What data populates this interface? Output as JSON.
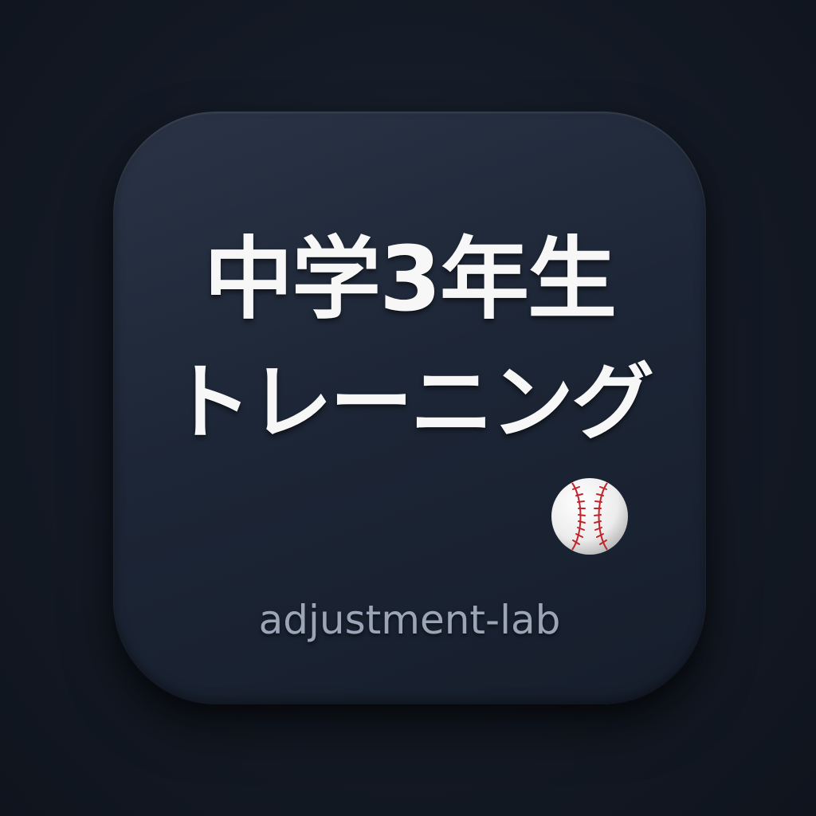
{
  "icon": {
    "title_line_1": "中学3年生",
    "title_line_2": "トレーニング",
    "brand": "adjustment-lab",
    "badge_icon": "baseball-icon"
  },
  "colors": {
    "background": "#141a25",
    "tile": "#1d2636",
    "title_text": "#f7f7f7",
    "brand_text": "#9aa6b6",
    "ball": "#f4f4f4",
    "stitches": "#c0262c"
  }
}
